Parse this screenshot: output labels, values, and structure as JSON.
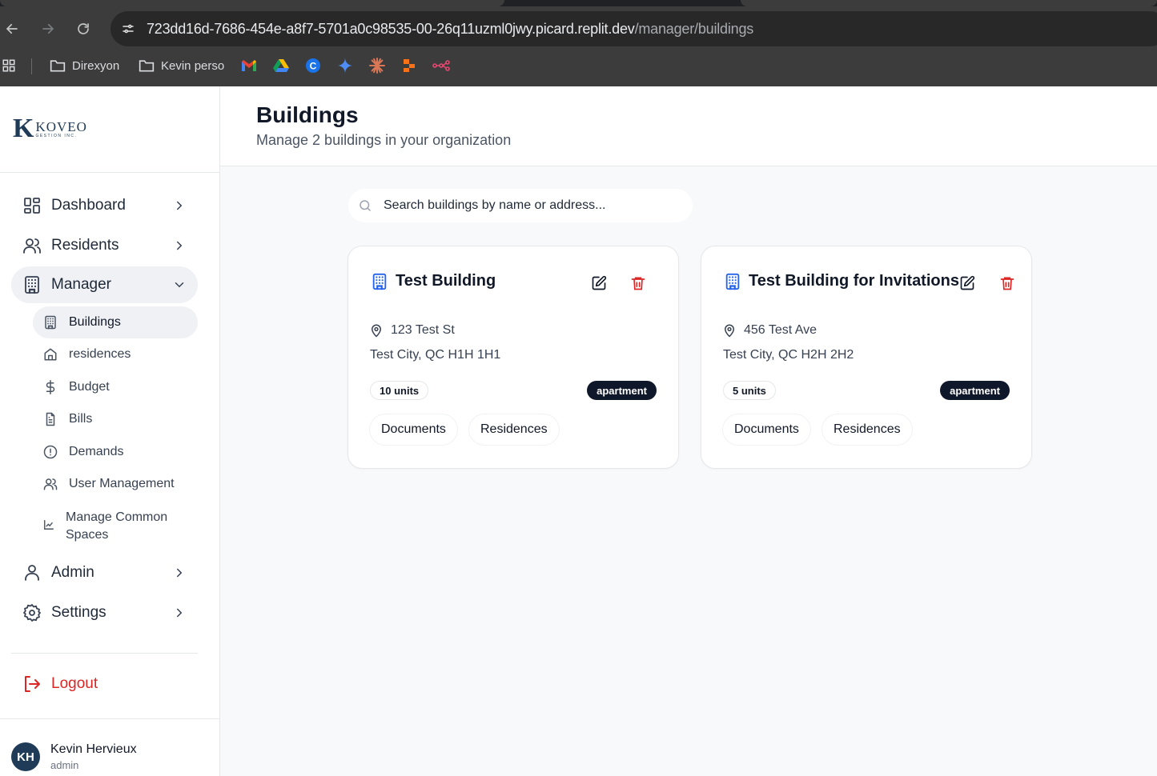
{
  "browser": {
    "url_main": "723dd16d-7686-454e-a8f7-5701a0c98535-00-26q11uzml0jwy.picard.replit.dev",
    "url_path": "/manager/buildings",
    "bookmarks": [
      {
        "label": "Direxyon",
        "icon": "folder-icon"
      },
      {
        "label": "Kevin perso",
        "icon": "folder-icon"
      }
    ],
    "bookmark_icons": [
      "gmail-icon",
      "google-drive-icon",
      "c-app-icon",
      "gemini-icon",
      "claude-icon",
      "make-icon",
      "n8n-icon"
    ]
  },
  "sidebar": {
    "logo_name": "KOVEO",
    "logo_sub": "GESTION INC.",
    "nav": [
      {
        "label": "Dashboard",
        "icon": "dashboard-icon"
      },
      {
        "label": "Residents",
        "icon": "users-icon"
      },
      {
        "label": "Manager",
        "icon": "building-icon",
        "expanded": true
      },
      {
        "label": "Admin",
        "icon": "user-icon"
      },
      {
        "label": "Settings",
        "icon": "gear-icon"
      }
    ],
    "manager_items": [
      {
        "label": "Buildings",
        "icon": "building-icon",
        "active": true
      },
      {
        "label": "residences",
        "icon": "home-icon"
      },
      {
        "label": "Budget",
        "icon": "dollar-icon"
      },
      {
        "label": "Bills",
        "icon": "file-icon"
      },
      {
        "label": "Demands",
        "icon": "alert-circle-icon"
      },
      {
        "label": "User Management",
        "icon": "users-icon"
      },
      {
        "label": "Manage Common Spaces",
        "icon": "chart-icon"
      }
    ],
    "logout": "Logout",
    "user": {
      "initials": "KH",
      "name": "Kevin Hervieux",
      "role": "admin"
    }
  },
  "header": {
    "title": "Buildings",
    "subtitle": "Manage 2 buildings in your organization"
  },
  "search": {
    "placeholder": "Search buildings by name or address..."
  },
  "buildings": [
    {
      "name": "Test Building",
      "address": "123 Test St",
      "city": "Test City, QC H1H 1H1",
      "units": "10 units",
      "type": "apartment",
      "documents_label": "Documents",
      "residences_label": "Residences"
    },
    {
      "name": "Test Building for Invitations",
      "address": "456 Test Ave",
      "city": "Test City, QC H2H 2H2",
      "units": "5 units",
      "type": "apartment",
      "documents_label": "Documents",
      "residences_label": "Residences"
    }
  ],
  "colors": {
    "accent": "#2563eb",
    "danger": "#dc2626",
    "badge_dark": "#0f172a",
    "brand": "#1f3b57"
  }
}
